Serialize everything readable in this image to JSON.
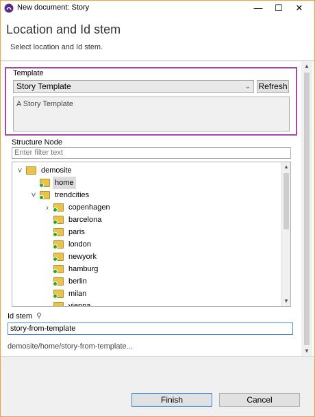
{
  "window": {
    "title": "New document: Story"
  },
  "header": {
    "title": "Location and Id stem",
    "subtitle": "Select location and Id stem."
  },
  "template": {
    "label": "Template",
    "selected": "Story Template",
    "refresh_label": "Refresh",
    "description": "A Story Template"
  },
  "structure": {
    "label": "Structure Node",
    "filter_placeholder": "Enter filter text",
    "tree": [
      {
        "label": "demosite",
        "depth": 0,
        "twisty": "expanded"
      },
      {
        "label": "home",
        "depth": 1,
        "twisty": "none",
        "selected": true
      },
      {
        "label": "trendcities",
        "depth": 1,
        "twisty": "expanded"
      },
      {
        "label": "copenhagen",
        "depth": 2,
        "twisty": "collapsed"
      },
      {
        "label": "barcelona",
        "depth": 2,
        "twisty": "none"
      },
      {
        "label": "paris",
        "depth": 2,
        "twisty": "none"
      },
      {
        "label": "london",
        "depth": 2,
        "twisty": "none"
      },
      {
        "label": "newyork",
        "depth": 2,
        "twisty": "none"
      },
      {
        "label": "hamburg",
        "depth": 2,
        "twisty": "none"
      },
      {
        "label": "berlin",
        "depth": 2,
        "twisty": "none"
      },
      {
        "label": "milan",
        "depth": 2,
        "twisty": "none"
      },
      {
        "label": "vienna",
        "depth": 2,
        "twisty": "none"
      }
    ]
  },
  "idstem": {
    "label": "Id stem",
    "value": "story-from-template",
    "path": "demosite/home/story-from-template..."
  },
  "footer": {
    "finish_label": "Finish",
    "cancel_label": "Cancel"
  },
  "colors": {
    "highlight_border": "#a44ca4",
    "focus_blue": "#3e89d8",
    "window_border": "#f0a23a"
  },
  "icons": {
    "app": "app-logo-icon",
    "folder": "folder-icon",
    "pin": "pin-icon"
  }
}
